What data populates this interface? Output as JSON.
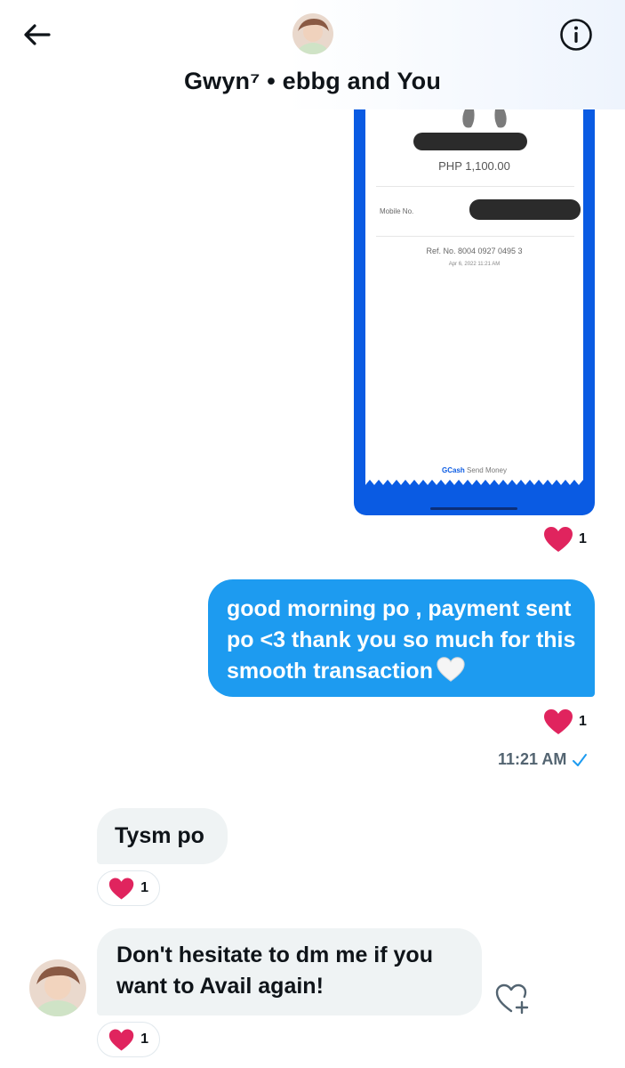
{
  "header": {
    "title": "Gwyn⁷ • ebbg and You",
    "back_icon": "arrow-left-icon",
    "info_icon": "info-circle-icon"
  },
  "receipt": {
    "amount": "PHP 1,100.00",
    "mobile_label": "Mobile No.",
    "reference": "Ref. No. 8004 0927 0495 3",
    "date": "Apr 6, 2022 11:21 AM",
    "brand": "GCash",
    "service": "Send Money"
  },
  "messages": {
    "receipt_reaction_count": "1",
    "outgoing_text": "good morning po , payment sent po <3 thank you so much for this smooth transaction",
    "outgoing_reaction_count": "1",
    "timestamp": "11:21 AM",
    "incoming": [
      {
        "text": "Tysm po",
        "reaction_count": "1"
      },
      {
        "text": "Don't hesitate to dm me if you want to Avail again!",
        "reaction_count": "1"
      }
    ]
  },
  "colors": {
    "accent": "#1d9bf0",
    "heart": "#f91880",
    "gcash_blue": "#0a5be3",
    "incoming_bubble": "#eff3f4"
  }
}
